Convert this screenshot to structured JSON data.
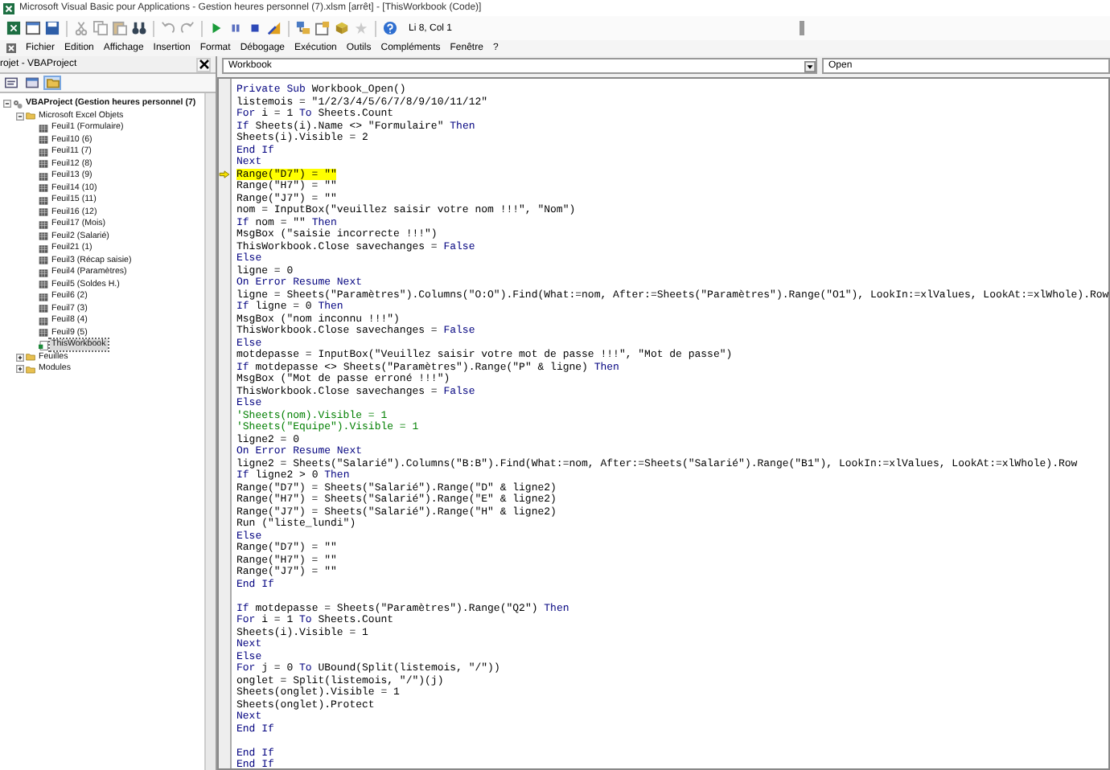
{
  "window": {
    "title": "Microsoft Visual Basic pour Applications - Gestion heures personnel (7).xlsm [arrêt] - [ThisWorkbook (Code)]"
  },
  "toolbar": {
    "position": "Li 8, Col 1"
  },
  "menu": [
    "Fichier",
    "Edition",
    "Affichage",
    "Insertion",
    "Format",
    "Débogage",
    "Exécution",
    "Outils",
    "Compléments",
    "Fenêtre",
    "?"
  ],
  "project_pane": {
    "title": "rojet - VBAProject",
    "tree": [
      {
        "label": "VBAProject (Gestion heures personnel (7)",
        "kind": "project",
        "expanded": true,
        "selected": false,
        "children": [
          {
            "label": "Microsoft Excel Objets",
            "kind": "folder",
            "expanded": true,
            "selected": false,
            "children": [
              {
                "label": "Feuil1 (Formulaire)",
                "kind": "sheet",
                "selected": false
              },
              {
                "label": "Feuil10 (6)",
                "kind": "sheet",
                "selected": false
              },
              {
                "label": "Feuil11 (7)",
                "kind": "sheet",
                "selected": false
              },
              {
                "label": "Feuil12 (8)",
                "kind": "sheet",
                "selected": false
              },
              {
                "label": "Feuil13 (9)",
                "kind": "sheet",
                "selected": false
              },
              {
                "label": "Feuil14 (10)",
                "kind": "sheet",
                "selected": false
              },
              {
                "label": "Feuil15 (11)",
                "kind": "sheet",
                "selected": false
              },
              {
                "label": "Feuil16 (12)",
                "kind": "sheet",
                "selected": false
              },
              {
                "label": "Feuil17 (Mois)",
                "kind": "sheet",
                "selected": false
              },
              {
                "label": "Feuil2 (Salarié)",
                "kind": "sheet",
                "selected": false
              },
              {
                "label": "Feuil21 (1)",
                "kind": "sheet",
                "selected": false
              },
              {
                "label": "Feuil3 (Récap saisie)",
                "kind": "sheet",
                "selected": false
              },
              {
                "label": "Feuil4 (Paramètres)",
                "kind": "sheet",
                "selected": false
              },
              {
                "label": "Feuil5 (Soldes H.)",
                "kind": "sheet",
                "selected": false
              },
              {
                "label": "Feuil6 (2)",
                "kind": "sheet",
                "selected": false
              },
              {
                "label": "Feuil7 (3)",
                "kind": "sheet",
                "selected": false
              },
              {
                "label": "Feuil8 (4)",
                "kind": "sheet",
                "selected": false
              },
              {
                "label": "Feuil9 (5)",
                "kind": "sheet",
                "selected": false
              },
              {
                "label": "ThisWorkbook",
                "kind": "workbook",
                "selected": true
              }
            ]
          },
          {
            "label": "Feuilles",
            "kind": "folder",
            "expanded": false,
            "selected": false
          },
          {
            "label": "Modules",
            "kind": "folder",
            "expanded": false,
            "selected": false
          }
        ]
      }
    ]
  },
  "code_pane": {
    "object": "Workbook",
    "procedure": "Open",
    "lines": [
      {
        "current": false,
        "parts": [
          {
            "kind": "keyword",
            "text": "Private Sub"
          },
          {
            "kind": "plain",
            "text": " Workbook_Open()"
          }
        ]
      },
      {
        "current": false,
        "parts": [
          {
            "kind": "plain",
            "text": "listemois = \"1/2/3/4/5/6/7/8/9/10/11/12\""
          }
        ]
      },
      {
        "current": false,
        "parts": [
          {
            "kind": "keyword",
            "text": "For"
          },
          {
            "kind": "plain",
            "text": " i = 1 "
          },
          {
            "kind": "keyword",
            "text": "To"
          },
          {
            "kind": "plain",
            "text": " Sheets.Count"
          }
        ]
      },
      {
        "current": false,
        "parts": [
          {
            "kind": "keyword",
            "text": "If"
          },
          {
            "kind": "plain",
            "text": " Sheets(i).Name <> \"Formulaire\" "
          },
          {
            "kind": "keyword",
            "text": "Then"
          }
        ]
      },
      {
        "current": false,
        "parts": [
          {
            "kind": "plain",
            "text": "Sheets(i).Visible = 2"
          }
        ]
      },
      {
        "current": false,
        "parts": [
          {
            "kind": "keyword",
            "text": "End If"
          }
        ]
      },
      {
        "current": false,
        "parts": [
          {
            "kind": "keyword",
            "text": "Next"
          }
        ]
      },
      {
        "current": true,
        "parts": [
          {
            "kind": "plain",
            "text": "Range(\"D7\") = \"\""
          }
        ]
      },
      {
        "current": false,
        "parts": [
          {
            "kind": "plain",
            "text": "Range(\"H7\") = \"\""
          }
        ]
      },
      {
        "current": false,
        "parts": [
          {
            "kind": "plain",
            "text": "Range(\"J7\") = \"\""
          }
        ]
      },
      {
        "current": false,
        "parts": [
          {
            "kind": "plain",
            "text": "nom = InputBox(\"veuillez saisir votre nom !!!\", \"Nom\")"
          }
        ]
      },
      {
        "current": false,
        "parts": [
          {
            "kind": "keyword",
            "text": "If"
          },
          {
            "kind": "plain",
            "text": " nom = \"\" "
          },
          {
            "kind": "keyword",
            "text": "Then"
          }
        ]
      },
      {
        "current": false,
        "parts": [
          {
            "kind": "plain",
            "text": "MsgBox (\"saisie incorrecte !!!\")"
          }
        ]
      },
      {
        "current": false,
        "parts": [
          {
            "kind": "plain",
            "text": "ThisWorkbook.Close savechanges = "
          },
          {
            "kind": "keyword",
            "text": "False"
          }
        ]
      },
      {
        "current": false,
        "parts": [
          {
            "kind": "keyword",
            "text": "Else"
          }
        ]
      },
      {
        "current": false,
        "parts": [
          {
            "kind": "plain",
            "text": "ligne = 0"
          }
        ]
      },
      {
        "current": false,
        "parts": [
          {
            "kind": "keyword",
            "text": "On Error Resume Next"
          }
        ]
      },
      {
        "current": false,
        "parts": [
          {
            "kind": "plain",
            "text": "ligne = Sheets(\"Paramètres\").Columns(\"O:O\").Find(What:=nom, After:=Sheets(\"Paramètres\").Range(\"O1\"), LookIn:=xlValues, LookAt:=xlWhole).Row"
          }
        ]
      },
      {
        "current": false,
        "parts": [
          {
            "kind": "keyword",
            "text": "If"
          },
          {
            "kind": "plain",
            "text": " ligne = 0 "
          },
          {
            "kind": "keyword",
            "text": "Then"
          }
        ]
      },
      {
        "current": false,
        "parts": [
          {
            "kind": "plain",
            "text": "MsgBox (\"nom inconnu !!!\")"
          }
        ]
      },
      {
        "current": false,
        "parts": [
          {
            "kind": "plain",
            "text": "ThisWorkbook.Close savechanges = "
          },
          {
            "kind": "keyword",
            "text": "False"
          }
        ]
      },
      {
        "current": false,
        "parts": [
          {
            "kind": "keyword",
            "text": "Else"
          }
        ]
      },
      {
        "current": false,
        "parts": [
          {
            "kind": "plain",
            "text": "motdepasse = InputBox(\"Veuillez saisir votre mot de passe !!!\", \"Mot de passe\")"
          }
        ]
      },
      {
        "current": false,
        "parts": [
          {
            "kind": "keyword",
            "text": "If"
          },
          {
            "kind": "plain",
            "text": " motdepasse <> Sheets(\"Paramètres\").Range(\"P\" & ligne) "
          },
          {
            "kind": "keyword",
            "text": "Then"
          }
        ]
      },
      {
        "current": false,
        "parts": [
          {
            "kind": "plain",
            "text": "MsgBox (\"Mot de passe erroné !!!\")"
          }
        ]
      },
      {
        "current": false,
        "parts": [
          {
            "kind": "plain",
            "text": "ThisWorkbook.Close savechanges = "
          },
          {
            "kind": "keyword",
            "text": "False"
          }
        ]
      },
      {
        "current": false,
        "parts": [
          {
            "kind": "keyword",
            "text": "Else"
          }
        ]
      },
      {
        "current": false,
        "parts": [
          {
            "kind": "comment",
            "text": "'Sheets(nom).Visible = 1"
          }
        ]
      },
      {
        "current": false,
        "parts": [
          {
            "kind": "comment",
            "text": "'Sheets(\"Equipe\").Visible = 1"
          }
        ]
      },
      {
        "current": false,
        "parts": [
          {
            "kind": "plain",
            "text": "ligne2 = 0"
          }
        ]
      },
      {
        "current": false,
        "parts": [
          {
            "kind": "keyword",
            "text": "On Error Resume Next"
          }
        ]
      },
      {
        "current": false,
        "parts": [
          {
            "kind": "plain",
            "text": "ligne2 = Sheets(\"Salarié\").Columns(\"B:B\").Find(What:=nom, After:=Sheets(\"Salarié\").Range(\"B1\"), LookIn:=xlValues, LookAt:=xlWhole).Row"
          }
        ]
      },
      {
        "current": false,
        "parts": [
          {
            "kind": "keyword",
            "text": "If"
          },
          {
            "kind": "plain",
            "text": " ligne2 > 0 "
          },
          {
            "kind": "keyword",
            "text": "Then"
          }
        ]
      },
      {
        "current": false,
        "parts": [
          {
            "kind": "plain",
            "text": "Range(\"D7\") = Sheets(\"Salarié\").Range(\"D\" & ligne2)"
          }
        ]
      },
      {
        "current": false,
        "parts": [
          {
            "kind": "plain",
            "text": "Range(\"H7\") = Sheets(\"Salarié\").Range(\"E\" & ligne2)"
          }
        ]
      },
      {
        "current": false,
        "parts": [
          {
            "kind": "plain",
            "text": "Range(\"J7\") = Sheets(\"Salarié\").Range(\"H\" & ligne2)"
          }
        ]
      },
      {
        "current": false,
        "parts": [
          {
            "kind": "plain",
            "text": "Run (\"liste_lundi\")"
          }
        ]
      },
      {
        "current": false,
        "parts": [
          {
            "kind": "keyword",
            "text": "Else"
          }
        ]
      },
      {
        "current": false,
        "parts": [
          {
            "kind": "plain",
            "text": "Range(\"D7\") = \"\""
          }
        ]
      },
      {
        "current": false,
        "parts": [
          {
            "kind": "plain",
            "text": "Range(\"H7\") = \"\""
          }
        ]
      },
      {
        "current": false,
        "parts": [
          {
            "kind": "plain",
            "text": "Range(\"J7\") = \"\""
          }
        ]
      },
      {
        "current": false,
        "parts": [
          {
            "kind": "keyword",
            "text": "End If"
          }
        ]
      },
      {
        "current": false
      },
      {
        "current": false,
        "parts": [
          {
            "kind": "keyword",
            "text": "If"
          },
          {
            "kind": "plain",
            "text": " motdepasse = Sheets(\"Paramètres\").Range(\"Q2\") "
          },
          {
            "kind": "keyword",
            "text": "Then"
          }
        ]
      },
      {
        "current": false,
        "parts": [
          {
            "kind": "keyword",
            "text": "For"
          },
          {
            "kind": "plain",
            "text": " i = 1 "
          },
          {
            "kind": "keyword",
            "text": "To"
          },
          {
            "kind": "plain",
            "text": " Sheets.Count"
          }
        ]
      },
      {
        "current": false,
        "parts": [
          {
            "kind": "plain",
            "text": "Sheets(i).Visible = 1"
          }
        ]
      },
      {
        "current": false,
        "parts": [
          {
            "kind": "keyword",
            "text": "Next"
          }
        ]
      },
      {
        "current": false,
        "parts": [
          {
            "kind": "keyword",
            "text": "Else"
          }
        ]
      },
      {
        "current": false,
        "parts": [
          {
            "kind": "keyword",
            "text": "For"
          },
          {
            "kind": "plain",
            "text": " j = 0 "
          },
          {
            "kind": "keyword",
            "text": "To"
          },
          {
            "kind": "plain",
            "text": " UBound(Split(listemois, \"/\"))"
          }
        ]
      },
      {
        "current": false,
        "parts": [
          {
            "kind": "plain",
            "text": "onglet = Split(listemois, \"/\")(j)"
          }
        ]
      },
      {
        "current": false,
        "parts": [
          {
            "kind": "plain",
            "text": "Sheets(onglet).Visible = 1"
          }
        ]
      },
      {
        "current": false,
        "parts": [
          {
            "kind": "plain",
            "text": "Sheets(onglet).Protect"
          }
        ]
      },
      {
        "current": false,
        "parts": [
          {
            "kind": "keyword",
            "text": "Next"
          }
        ]
      },
      {
        "current": false,
        "parts": [
          {
            "kind": "keyword",
            "text": "End If"
          }
        ]
      },
      {
        "current": false
      },
      {
        "current": false,
        "parts": [
          {
            "kind": "keyword",
            "text": "End If"
          }
        ]
      },
      {
        "current": false,
        "parts": [
          {
            "kind": "keyword",
            "text": "End If"
          }
        ]
      }
    ]
  }
}
